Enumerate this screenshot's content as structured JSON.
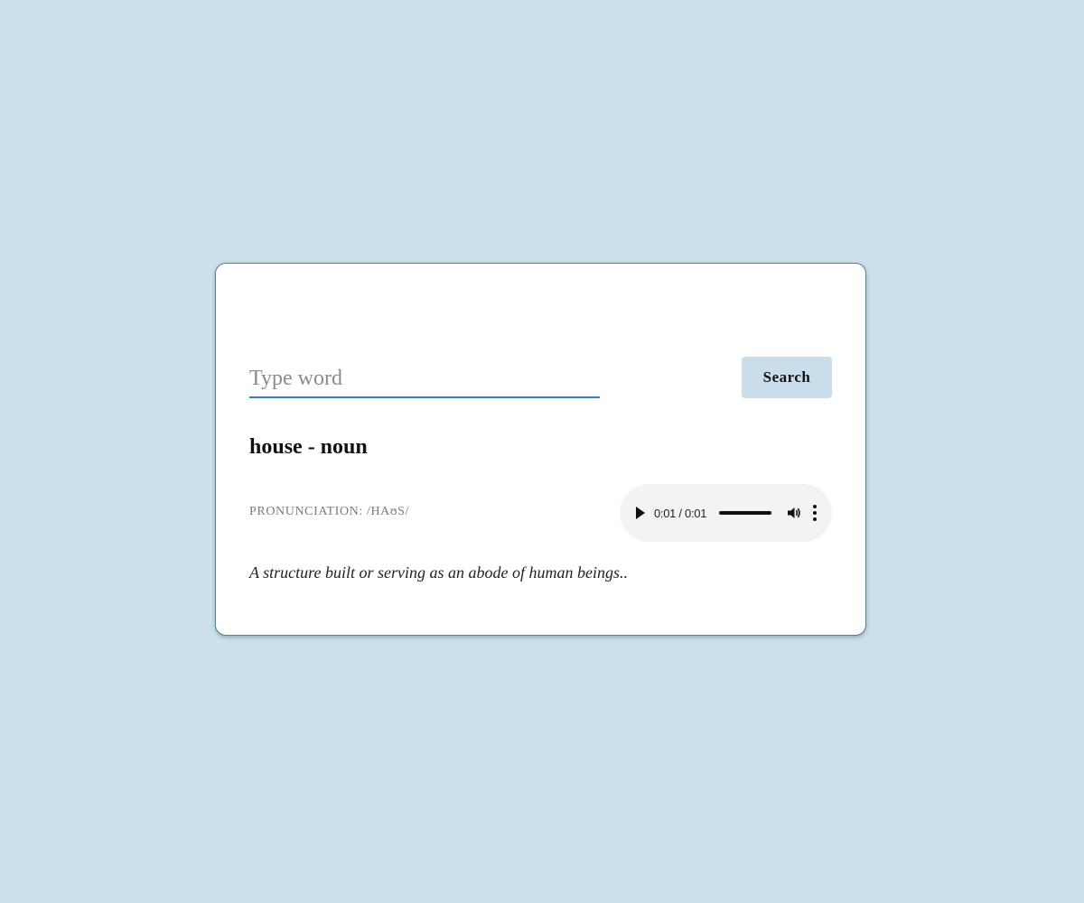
{
  "search": {
    "placeholder": "Type word",
    "value": "",
    "button_label": "Search"
  },
  "result": {
    "title": "house - noun",
    "pronunciation": "PRONUNCIATION: /HAʊS/",
    "definition": "A structure built or serving as an abode of human beings.."
  },
  "audio": {
    "time": "0:01 / 0:01",
    "progress": 1.0,
    "icons": [
      "play-icon",
      "volume-icon",
      "more-options-icon"
    ]
  },
  "colors": {
    "page_background": "#cbe0ea",
    "button_background": "#c9deea",
    "input_underline": "#3b7cb8",
    "card_border": "#5f7f8f"
  }
}
